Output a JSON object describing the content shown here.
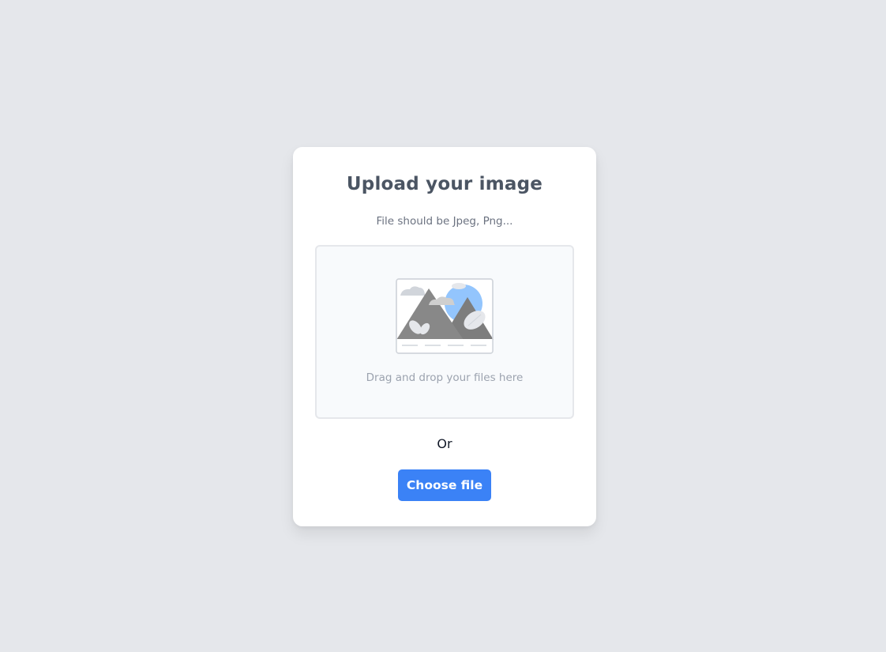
{
  "upload": {
    "title": "Upload your image",
    "subtitle": "File should be Jpeg, Png...",
    "dropzone_text": "Drag and drop your files here",
    "or_text": "Or",
    "choose_button_label": "Choose file",
    "illustration_icon": "image-placeholder-icon"
  },
  "colors": {
    "background": "#e5e7eb",
    "card": "#ffffff",
    "accent": "#3b82f6",
    "dropzone_bg": "#f8fafc",
    "dropzone_border": "#e5e7eb"
  }
}
